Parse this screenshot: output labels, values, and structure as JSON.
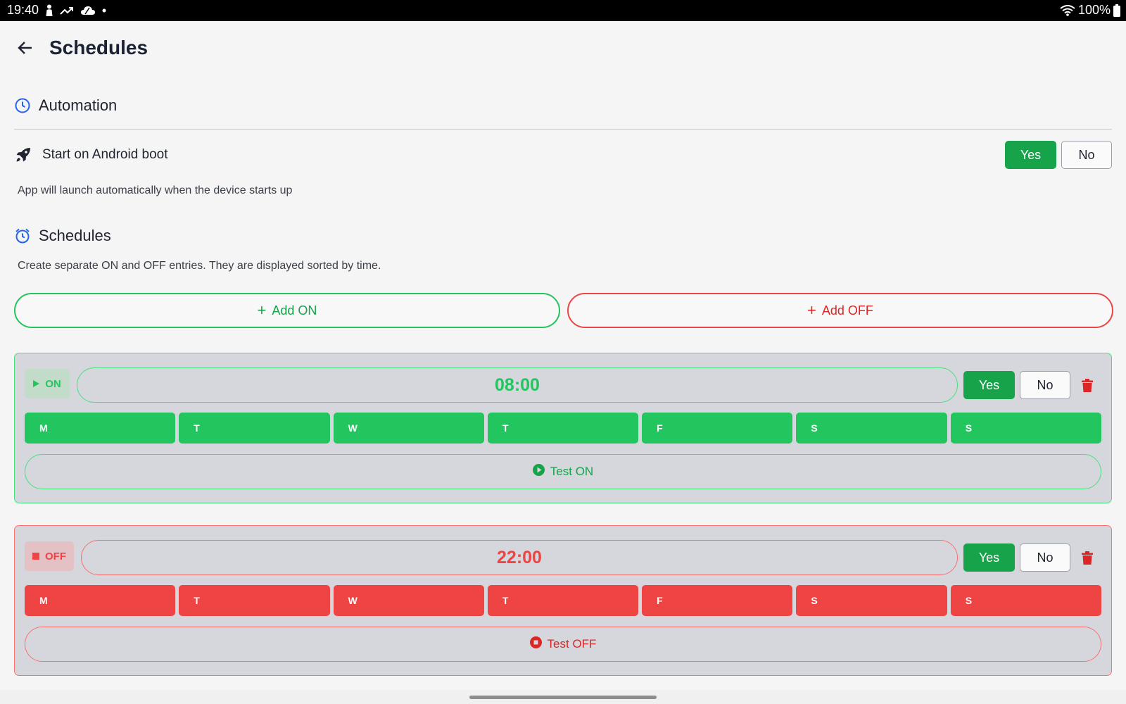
{
  "status_bar": {
    "time": "19:40",
    "battery": "100%",
    "icons": [
      "person-icon",
      "trending-icon",
      "cloud-icon",
      "dot-icon",
      "wifi-icon",
      "battery-icon"
    ]
  },
  "app_bar": {
    "title": "Schedules",
    "back_icon": "arrow-left-icon"
  },
  "automation": {
    "heading": "Automation",
    "icon": "clock-icon",
    "boot_setting": {
      "label": "Start on Android boot",
      "icon": "rocket-icon",
      "yes_label": "Yes",
      "no_label": "No",
      "selected": "Yes",
      "description": "App will launch automatically when the device starts up"
    }
  },
  "schedules": {
    "heading": "Schedules",
    "icon": "alarm-clock-icon",
    "description": "Create separate ON and OFF entries. They are displayed sorted by time.",
    "add_on_label": "Add ON",
    "add_off_label": "Add OFF",
    "entries": [
      {
        "type": "on",
        "badge": "ON",
        "time": "08:00",
        "yes_label": "Yes",
        "no_label": "No",
        "enabled": "Yes",
        "days": [
          "M",
          "T",
          "W",
          "T",
          "F",
          "S",
          "S"
        ],
        "test_label": "Test ON"
      },
      {
        "type": "off",
        "badge": "OFF",
        "time": "22:00",
        "yes_label": "Yes",
        "no_label": "No",
        "enabled": "Yes",
        "days": [
          "M",
          "T",
          "W",
          "T",
          "F",
          "S",
          "S"
        ],
        "test_label": "Test OFF"
      }
    ]
  },
  "colors": {
    "on_accent": "#22c55e",
    "off_accent": "#ef4444",
    "yes_button": "#16a34a",
    "primary_icon": "#2563eb"
  }
}
